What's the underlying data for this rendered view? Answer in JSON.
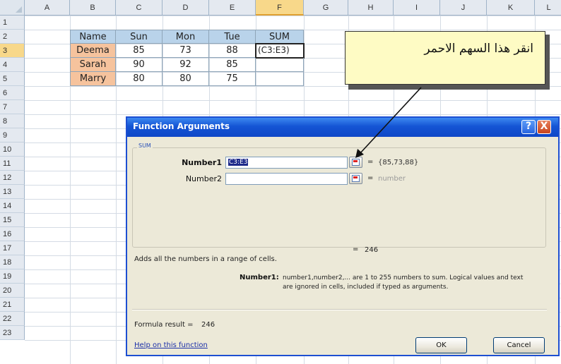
{
  "spreadsheet": {
    "columns": [
      "A",
      "B",
      "C",
      "D",
      "E",
      "F",
      "G",
      "H",
      "I",
      "J",
      "K",
      "L"
    ],
    "selected_column": "F",
    "rows": [
      "1",
      "2",
      "3",
      "4",
      "5",
      "6",
      "7",
      "8",
      "9",
      "10",
      "11",
      "12",
      "13",
      "14",
      "15",
      "16",
      "17",
      "18",
      "19",
      "20",
      "21",
      "22",
      "23"
    ],
    "selected_row": "3",
    "table": {
      "headers": [
        "Name",
        "Sun",
        "Mon",
        "Tue",
        "SUM"
      ],
      "rows": [
        [
          "Deema",
          "85",
          "73",
          "88",
          "(C3:E3)"
        ],
        [
          "Sarah",
          "90",
          "92",
          "85",
          ""
        ],
        [
          "Marry",
          "80",
          "80",
          "75",
          ""
        ]
      ]
    }
  },
  "callout": {
    "text": "انقر هذا السهم الاحمر"
  },
  "dialog": {
    "title": "Function Arguments",
    "help_button": "?",
    "close_button": "X",
    "function_name": "SUM",
    "args": [
      {
        "label": "Number1",
        "value": "C3:E3",
        "result": "{85,73,88}"
      },
      {
        "label": "Number2",
        "value": "",
        "result": "number"
      }
    ],
    "eq": "=",
    "total_result": "246",
    "description": "Adds all the numbers in a range of cells.",
    "param_name": "Number1:",
    "param_help_line1": "number1,number2,... are 1 to 255 numbers to sum. Logical values and text",
    "param_help_line2": "are ignored in cells, included if typed as arguments.",
    "formula_result_label": "Formula result =",
    "formula_result_value": "246",
    "help_link": "Help on this function",
    "ok_label": "OK",
    "cancel_label": "Cancel"
  }
}
